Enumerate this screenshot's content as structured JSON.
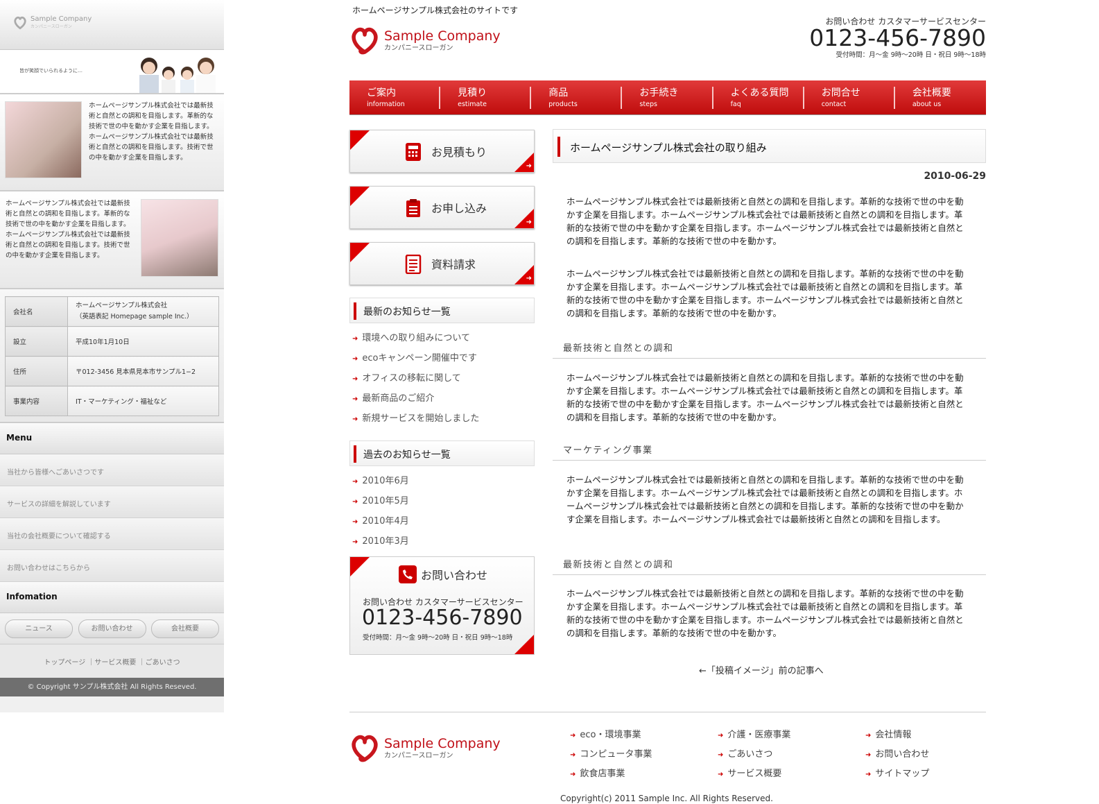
{
  "mobile": {
    "logo_name": "Sample Company",
    "logo_slogan": "カンパニースローガン",
    "hero_caption": "皆が笑顔でいられるように…",
    "profile1_text": "ホームページサンプル株式会社では最新技術と自然との調和を目指します。革新的な技術で世の中を動かす企業を目指します。ホームページサンプル株式会社では最新技術と自然との調和を目指します。技術で世の中を動かす企業を目指します。",
    "profile2_text": "ホームページサンプル株式会社では最新技術と自然との調和を目指します。革新的な技術で世の中を動かす企業を目指します。ホームページサンプル株式会社では最新技術と自然との調和を目指します。技術で世の中を動かす企業を目指します。",
    "company_table": [
      {
        "k": "会社名",
        "v": "ホームページサンプル株式会社\n（英語表記 Homepage sample Inc.）"
      },
      {
        "k": "設立",
        "v": "平成10年1月10日"
      },
      {
        "k": "住所",
        "v": "〒012-3456 見本県見本市サンプル1−2"
      },
      {
        "k": "事業内容",
        "v": "IT・マーケティング・福祉など"
      }
    ],
    "menu_title": "Menu",
    "menu_items": [
      "当社から皆様へごあいさつです",
      "サービスの詳細を解説しています",
      "当社の会社概要について確認する",
      "お問い合わせはこちらから"
    ],
    "info_title": "Infomation",
    "info_buttons": [
      "ニュース",
      "お問い合わせ",
      "会社概要"
    ],
    "footer_links": "トップページ ｜サービス概要 ｜ごあいさつ",
    "copyright": "© Copyright サンプル株式会社 All Rights Reseved."
  },
  "header": {
    "topline": "ホームページサンプル株式会社のサイトです",
    "logo_name": "Sample Company",
    "logo_slogan": "カンパニースローガン",
    "contact_label": "お問い合わせ カスタマーサービスセンター",
    "phone": "0123-456-7890",
    "hours": "受付時間：月〜金 9時〜20時 日・祝日 9時〜18時"
  },
  "nav": [
    {
      "ja": "ご案内",
      "en": "information"
    },
    {
      "ja": "見積り",
      "en": "estimate"
    },
    {
      "ja": "商品",
      "en": "products"
    },
    {
      "ja": "お手続き",
      "en": "steps"
    },
    {
      "ja": "よくある質問",
      "en": "faq"
    },
    {
      "ja": "お問合せ",
      "en": "contact"
    },
    {
      "ja": "会社概要",
      "en": "about us"
    }
  ],
  "side": {
    "btn1": "お見積もり",
    "btn2": "お申し込み",
    "btn3": "資料請求",
    "latest_title": "最新のお知らせ一覧",
    "latest": [
      "環境への取り組みについて",
      "ecoキャンペーン開催中です",
      "オフィスの移転に関して",
      "最新商品のご紹介",
      "新規サービスを開始しました"
    ],
    "past_title": "過去のお知らせ一覧",
    "past": [
      "2010年6月",
      "2010年5月",
      "2010年4月",
      "2010年3月"
    ],
    "contact_title": "お問い合わせ",
    "contact_label": "お問い合わせ カスタマーサービスセンター",
    "phone": "0123-456-7890",
    "hours": "受付時間：月〜金 9時〜20時 日・祝日 9時〜18時"
  },
  "main": {
    "title": "ホームページサンプル株式会社の取り組み",
    "date": "2010-06-29",
    "p1": "ホームページサンプル株式会社では最新技術と自然との調和を目指します。革新的な技術で世の中を動かす企業を目指します。ホームページサンプル株式会社では最新技術と自然との調和を目指します。革新的な技術で世の中を動かす企業を目指します。ホームページサンプル株式会社では最新技術と自然との調和を目指します。革新的な技術で世の中を動かす。",
    "p2": "ホームページサンプル株式会社では最新技術と自然との調和を目指します。革新的な技術で世の中を動かす企業を目指します。ホームページサンプル株式会社では最新技術と自然との調和を目指します。革新的な技術で世の中を動かす企業を目指します。ホームページサンプル株式会社では最新技術と自然との調和を目指します。革新的な技術で世の中を動かす。",
    "h1": "最新技術と自然との調和",
    "p3": "ホームページサンプル株式会社では最新技術と自然との調和を目指します。革新的な技術で世の中を動かす企業を目指します。ホームページサンプル株式会社では最新技術と自然との調和を目指します。革新的な技術で世の中を動かす企業を目指します。ホームページサンプル株式会社では最新技術と自然との調和を目指します。革新的な技術で世の中を動かす。",
    "h2": "マーケティング事業",
    "p4": "ホームページサンプル株式会社では最新技術と自然との調和を目指します。革新的な技術で世の中を動かす企業を目指します。ホームページサンプル株式会社では最新技術と自然との調和を目指します。ホームページサンプル株式会社では最新技術と自然との調和を目指します。革新的な技術で世の中を動かす企業を目指します。ホームページサンプル株式会社では最新技術と自然との調和を目指します。",
    "h3": "最新技術と自然との調和",
    "p5": "ホームページサンプル株式会社では最新技術と自然との調和を目指します。革新的な技術で世の中を動かす企業を目指します。ホームページサンプル株式会社では最新技術と自然との調和を目指します。革新的な技術で世の中を動かす企業を目指します。ホームページサンプル株式会社では最新技術と自然との調和を目指します。革新的な技術で世の中を動かす。",
    "prev_link": "←「投稿イメージ」前の記事へ"
  },
  "footer": {
    "logo_name": "Sample Company",
    "logo_slogan": "カンパニースローガン",
    "col1": [
      "eco・環境事業",
      "コンピュータ事業",
      "飲食店事業"
    ],
    "col2": [
      "介護・医療事業",
      "ごあいさつ",
      "サービス概要"
    ],
    "col3": [
      "会社情報",
      "お問い合わせ",
      "サイトマップ"
    ],
    "copyright": "Copyright(c) 2011 Sample Inc. All Rights Reserved."
  },
  "colors": {
    "accent": "#cc0000",
    "nav_red": "#d61f1f"
  }
}
